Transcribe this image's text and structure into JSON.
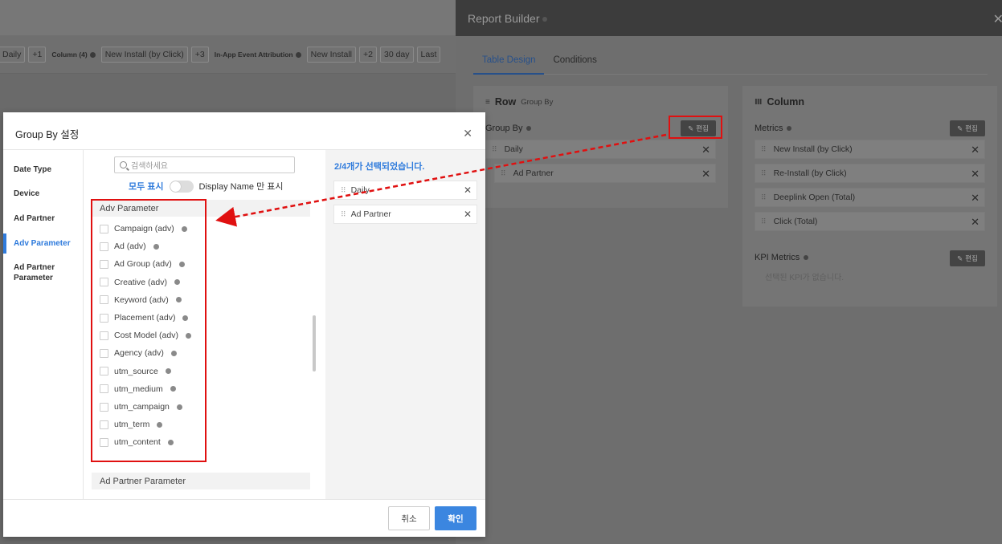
{
  "toolbar": {
    "chips": [
      {
        "text": "Daily",
        "kind": "chip"
      },
      {
        "text": "+1",
        "kind": "chip"
      },
      {
        "text": "Column (4)",
        "kind": "label"
      },
      {
        "text": "New Install (by Click)",
        "kind": "chip"
      },
      {
        "text": "+3",
        "kind": "chip"
      },
      {
        "text": "In-App Event Attribution",
        "kind": "label"
      },
      {
        "text": "New Install",
        "kind": "chip"
      },
      {
        "text": "+2",
        "kind": "chip"
      },
      {
        "text": "30 day",
        "kind": "chip"
      },
      {
        "text": "Last",
        "kind": "chip"
      }
    ]
  },
  "report_builder": {
    "title": "Report Builder",
    "close_icon": "close-icon",
    "tabs": [
      "Table Design",
      "Conditions"
    ],
    "active_tab": 0,
    "row_panel": {
      "title": "Row",
      "subtitle": "Group By",
      "section_label": "Group By",
      "edit_label": "편집",
      "items": [
        "Daily",
        "Ad Partner"
      ]
    },
    "column_panel": {
      "title": "Column",
      "metrics_label": "Metrics",
      "edit_label": "편집",
      "metrics": [
        "New Install (by Click)",
        "Re-Install (by Click)",
        "Deeplink Open (Total)",
        "Click (Total)"
      ],
      "kpi_label": "KPI Metrics",
      "kpi_edit_label": "편집",
      "kpi_empty": "선택된 KPI가 없습니다."
    }
  },
  "modal": {
    "title": "Group By 설정",
    "categories": [
      "Date Type",
      "Device",
      "Ad Partner",
      "Adv Parameter",
      "Ad Partner Parameter"
    ],
    "active_category": 3,
    "search_placeholder": "검색하세요",
    "show_all_label": "모두 표시",
    "display_name_label": "Display Name 만 표시",
    "group_title": "Adv Parameter",
    "options": [
      "Campaign (adv)",
      "Ad (adv)",
      "Ad Group (adv)",
      "Creative (adv)",
      "Keyword (adv)",
      "Placement (adv)",
      "Cost Model (adv)",
      "Agency (adv)",
      "utm_source",
      "utm_medium",
      "utm_campaign",
      "utm_term",
      "utm_content"
    ],
    "next_group_title": "Ad Partner Parameter",
    "selected_count": "2/4개가 선택되었습니다.",
    "selected": [
      "Daily",
      "Ad Partner"
    ],
    "cancel_label": "취소",
    "confirm_label": "확인"
  },
  "colors": {
    "accent": "#2f7bdc",
    "highlight": "#e01010",
    "confirm_button": "#3b86e0"
  }
}
